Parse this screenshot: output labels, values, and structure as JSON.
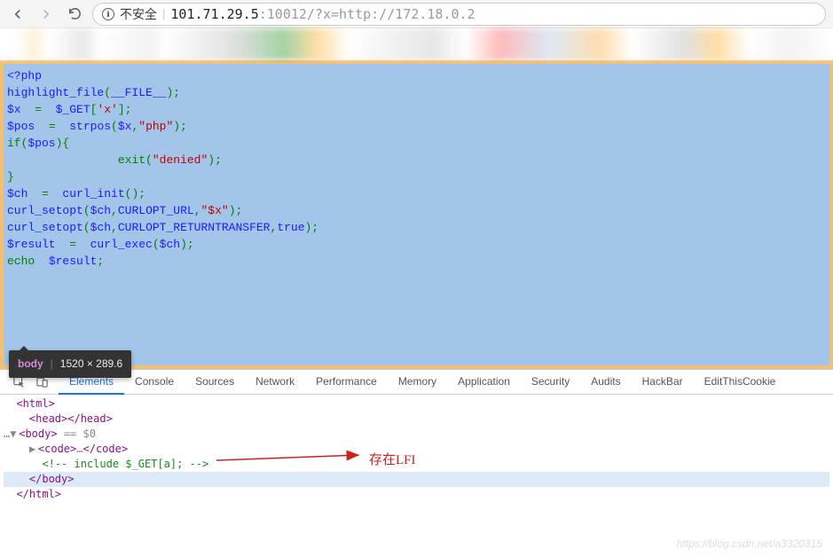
{
  "browser": {
    "insecure_label": "不安全",
    "url_host": "101.71.29.5",
    "url_path": ":10012/?x=http://172.18.0.2"
  },
  "code": {
    "line1_open": "<?php",
    "line2_a": "highlight_file",
    "line2_b": "(",
    "line2_c": "__FILE__",
    "line2_d": ");",
    "line3_a": "$x",
    "line3_b": "  =  ",
    "line3_c": "$_GET",
    "line3_d": "[",
    "line3_e": "'x'",
    "line3_f": "];",
    "line4_a": "$pos",
    "line4_b": "  =  ",
    "line4_c": "strpos",
    "line4_d": "(",
    "line4_e": "$x",
    "line4_f": ",",
    "line4_g": "\"php\"",
    "line4_h": ");",
    "line5_a": "if(",
    "line5_b": "$pos",
    "line5_c": "){",
    "line6_a": "                exit",
    "line6_b": "(",
    "line6_c": "\"denied\"",
    "line6_d": ");",
    "line7_a": "}",
    "line8_a": "$ch",
    "line8_b": "  =  ",
    "line8_c": "curl_init",
    "line8_d": "();",
    "line9_a": "curl_setopt",
    "line9_b": "(",
    "line9_c": "$ch",
    "line9_d": ",",
    "line9_e": "CURLOPT_URL",
    "line9_f": ",",
    "line9_g": "\"$x\"",
    "line9_h": ");",
    "line10_a": "curl_setopt",
    "line10_b": "(",
    "line10_c": "$ch",
    "line10_d": ",",
    "line10_e": "CURLOPT_RETURNTRANSFER",
    "line10_f": ",",
    "line10_g": "true",
    "line10_h": ");",
    "line11_a": "$result",
    "line11_b": "  =  ",
    "line11_c": "curl_exec",
    "line11_d": "(",
    "line11_e": "$ch",
    "line11_f": ");",
    "line12_a": "echo  ",
    "line12_b": "$result",
    "line12_c": ";",
    "tooltip_tag": "body",
    "tooltip_dim": "1520 × 289.6"
  },
  "devtools": {
    "tabs": {
      "elements": "Elements",
      "console": "Console",
      "sources": "Sources",
      "network": "Network",
      "performance": "Performance",
      "memory": "Memory",
      "application": "Application",
      "security": "Security",
      "audits": "Audits",
      "hackbar": "HackBar",
      "editcookie": "EditThisCookie"
    },
    "dom": {
      "html_open": "<html>",
      "head": "<head></head>",
      "body_open": "<body>",
      "body_eq": " == $0",
      "code_open": "<code>",
      "code_ellipsis": "…",
      "code_close": "</code>",
      "comment": "<!-- include $_GET[a]; -->",
      "body_close": "</body>",
      "html_close": "</html>"
    }
  },
  "annotation": {
    "lfi_text": "存在LFI"
  },
  "watermark": "https://blog.csdn.net/a3320315"
}
